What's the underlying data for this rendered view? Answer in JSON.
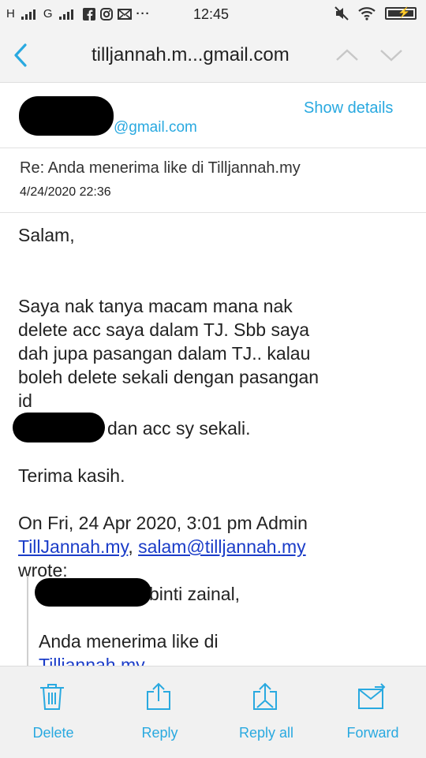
{
  "status_bar": {
    "left_labels": [
      "H",
      "G"
    ],
    "time": "12:45",
    "more": "···"
  },
  "header": {
    "title": "tilljannah.m...gmail.com"
  },
  "sender": {
    "domain": "@gmail.com",
    "show_details_label": "Show details"
  },
  "message": {
    "subject": "Re: Anda menerima like di Tilljannah.my",
    "date": "4/24/2020 22:36"
  },
  "body": {
    "greeting": "Salam,",
    "para_lines": [
      "Saya nak tanya macam mana nak",
      "delete acc saya dalam TJ. Sbb saya",
      "dah jupa pasangan dalam TJ.. kalau",
      "boleh delete sekali dengan pasangan",
      "id"
    ],
    "after_redaction": "dan acc sy sekali.",
    "thanks": "Terima kasih.",
    "quote_header_line": "On Fri, 24 Apr 2020, 3:01 pm Admin",
    "quote_link1": "TillJannah.my",
    "quote_comma": ", ",
    "quote_link2": "salam@tilljannah.my",
    "quote_wrote": "wrote:",
    "quoted_name_suffix": "binti zainal,",
    "quoted_line": "Anda menerima like di",
    "quoted_link": "Tilljannah.my"
  },
  "toolbar": {
    "delete_label": "Delete",
    "reply_label": "Reply",
    "reply_all_label": "Reply all",
    "forward_label": "Forward"
  },
  "colors": {
    "accent": "#29a9e0",
    "link": "#1a3cc8",
    "bar_bg": "#f3f3f3"
  },
  "icons": [
    "signal-icon",
    "facebook-icon",
    "instagram-icon",
    "mail-icon",
    "mute-icon",
    "wifi-icon",
    "battery-icon",
    "back-icon",
    "chevron-up-icon",
    "chevron-down-icon",
    "trash-icon",
    "reply-icon",
    "reply-all-icon",
    "forward-icon"
  ]
}
